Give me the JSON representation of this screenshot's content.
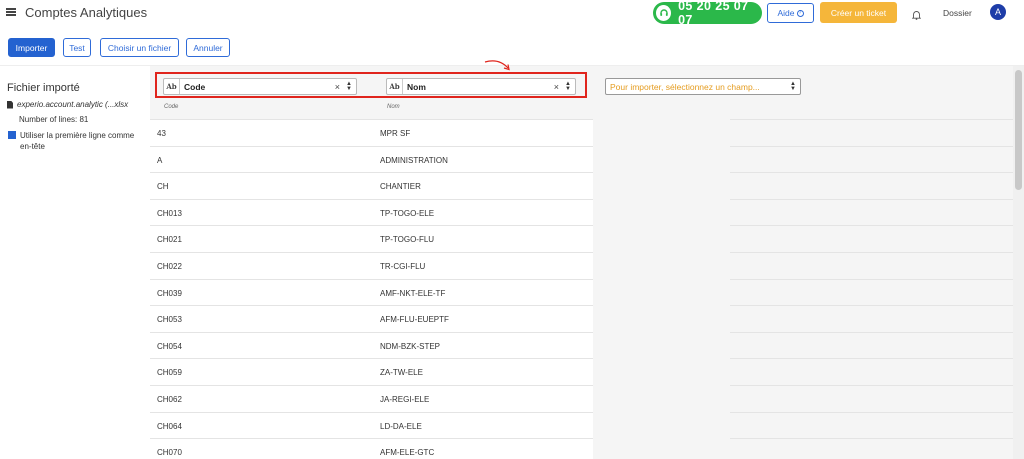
{
  "header": {
    "title": "Comptes Analytiques",
    "phone": "05 20 25 07 07",
    "help_label": "Aide",
    "ticket_label": "Créer un ticket",
    "dossier_label": "Dossier",
    "avatar_letter": "A"
  },
  "toolbar": {
    "import_label": "Importer",
    "test_label": "Test",
    "choose_file_label": "Choisir un fichier",
    "cancel_label": "Annuler"
  },
  "sidebar": {
    "title": "Fichier importé",
    "file_name": "experio.account.analytic (...xlsx",
    "line_count": "Number of lines: 81",
    "first_row_header_label": "Utiliser la première ligne comme en-tête",
    "first_row_header_checked": true
  },
  "mapping": {
    "col1": {
      "type_icon": "Ab",
      "value": "Code",
      "source_label": "Code"
    },
    "col2": {
      "type_icon": "Ab",
      "value": "Nom",
      "source_label": "Nom"
    },
    "col3": {
      "placeholder": "Pour importer, sélectionnez un champ..."
    }
  },
  "rows": [
    {
      "code": "43",
      "nom": "MPR SF"
    },
    {
      "code": "A",
      "nom": "ADMINISTRATION"
    },
    {
      "code": "CH",
      "nom": "CHANTIER"
    },
    {
      "code": "CH013",
      "nom": "TP-TOGO-ELE"
    },
    {
      "code": "CH021",
      "nom": "TP-TOGO-FLU"
    },
    {
      "code": "CH022",
      "nom": "TR-CGI-FLU"
    },
    {
      "code": "CH039",
      "nom": "AMF-NKT-ELE-TF"
    },
    {
      "code": "CH053",
      "nom": "AFM-FLU-EUEPTF"
    },
    {
      "code": "CH054",
      "nom": "NDM-BZK-STEP"
    },
    {
      "code": "CH059",
      "nom": "ZA-TW-ELE"
    },
    {
      "code": "CH062",
      "nom": "JA-REGI-ELE"
    },
    {
      "code": "CH064",
      "nom": "LD-DA-ELE"
    },
    {
      "code": "CH070",
      "nom": "AFM-ELE-GTC"
    }
  ],
  "colors": {
    "primary": "#2462d0",
    "phone_green": "#2bb84a",
    "ticket_orange": "#f5b63a",
    "highlight_red": "#e0251d"
  }
}
